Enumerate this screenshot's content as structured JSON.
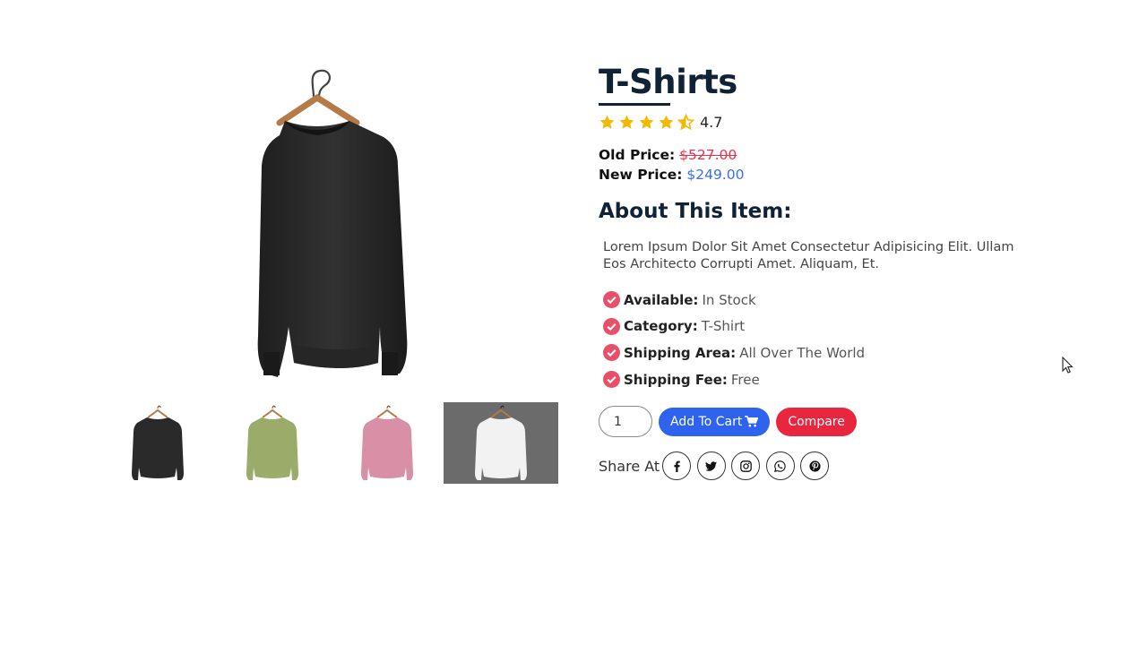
{
  "product": {
    "title": "T-Shirts",
    "rating": "4.7",
    "old_price_label": "Old Price:",
    "old_price": "$527.00",
    "new_price_label": "New Price:",
    "new_price": "$249.00"
  },
  "about": {
    "heading": "About This Item:",
    "description": "Lorem Ipsum Dolor Sit Amet Consectetur Adipisicing Elit. Ullam Eos Architecto Corrupti Amet. Aliquam, Et."
  },
  "specs": [
    {
      "label": "Available:",
      "value": "In Stock"
    },
    {
      "label": "Category:",
      "value": "T-Shirt"
    },
    {
      "label": "Shipping Area:",
      "value": "All Over The World"
    },
    {
      "label": "Shipping Fee:",
      "value": "Free"
    }
  ],
  "actions": {
    "quantity": "1",
    "add_to_cart": "Add To Cart",
    "compare": "Compare"
  },
  "share": {
    "label": "Share At",
    "icons": [
      "facebook-icon",
      "twitter-icon",
      "instagram-icon",
      "whatsapp-icon",
      "pinterest-icon"
    ]
  },
  "gallery": {
    "thumbnails": [
      {
        "color": "black",
        "hex": "#2a2a2a",
        "active": false
      },
      {
        "color": "green",
        "hex": "#9bab6a",
        "active": false
      },
      {
        "color": "pink",
        "hex": "#d98fa6",
        "active": false
      },
      {
        "color": "white",
        "hex": "#f2f2f2",
        "active": true
      }
    ],
    "main_color": "#2b2b2b"
  },
  "colors": {
    "title": "#0f2236",
    "star": "#f5b800",
    "check": "#e8506a",
    "old_price": "#e8344a",
    "new_price": "#3a6fe6",
    "cart_button": "#2e63f0",
    "compare_button": "#e8273f"
  }
}
